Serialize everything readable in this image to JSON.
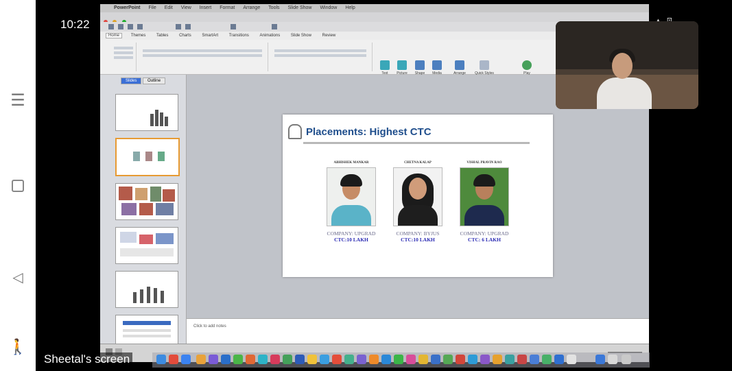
{
  "phone": {
    "time": "10:22",
    "status_icons": "VoLTE ▾ ▴ ⊡"
  },
  "share": {
    "label": "Sheetal's screen"
  },
  "mac": {
    "menu": [
      "PowerPoint",
      "File",
      "Edit",
      "View",
      "Insert",
      "Format",
      "Arrange",
      "Tools",
      "Slide Show",
      "Window",
      "Help"
    ]
  },
  "ppt": {
    "tabs": [
      "Home",
      "Themes",
      "Tables",
      "Charts",
      "SmartArt",
      "Transitions",
      "Animations",
      "Slide Show",
      "Review"
    ],
    "ribbon_buttons": [
      "Text",
      "Picture",
      "Shape",
      "Media",
      "Arrange",
      "Quick Styles",
      "Play"
    ],
    "sorter_tabs": [
      "Slides",
      "Outline"
    ],
    "notes_placeholder": "Click to add notes",
    "slide": {
      "title": "Placements: Highest CTC",
      "people": [
        {
          "name": "ABHISHEK MANKAR",
          "company": "COMPANY: UPGRAD",
          "ctc": "CTC:10 LAKH"
        },
        {
          "name": "CHETNA KALAP",
          "company": "COMPANY: BYJUS",
          "ctc": "CTC:10 LAKH"
        },
        {
          "name": "VISHAL PRAVIN RAO",
          "company": "COMPANY: UPGRAD",
          "ctc": "CTC: 6 LAKH"
        }
      ]
    }
  },
  "colors": {
    "title_blue": "#1f4e8c",
    "ctc_blue": "#2c2cb4",
    "selected_thumb": "#e79a32"
  }
}
